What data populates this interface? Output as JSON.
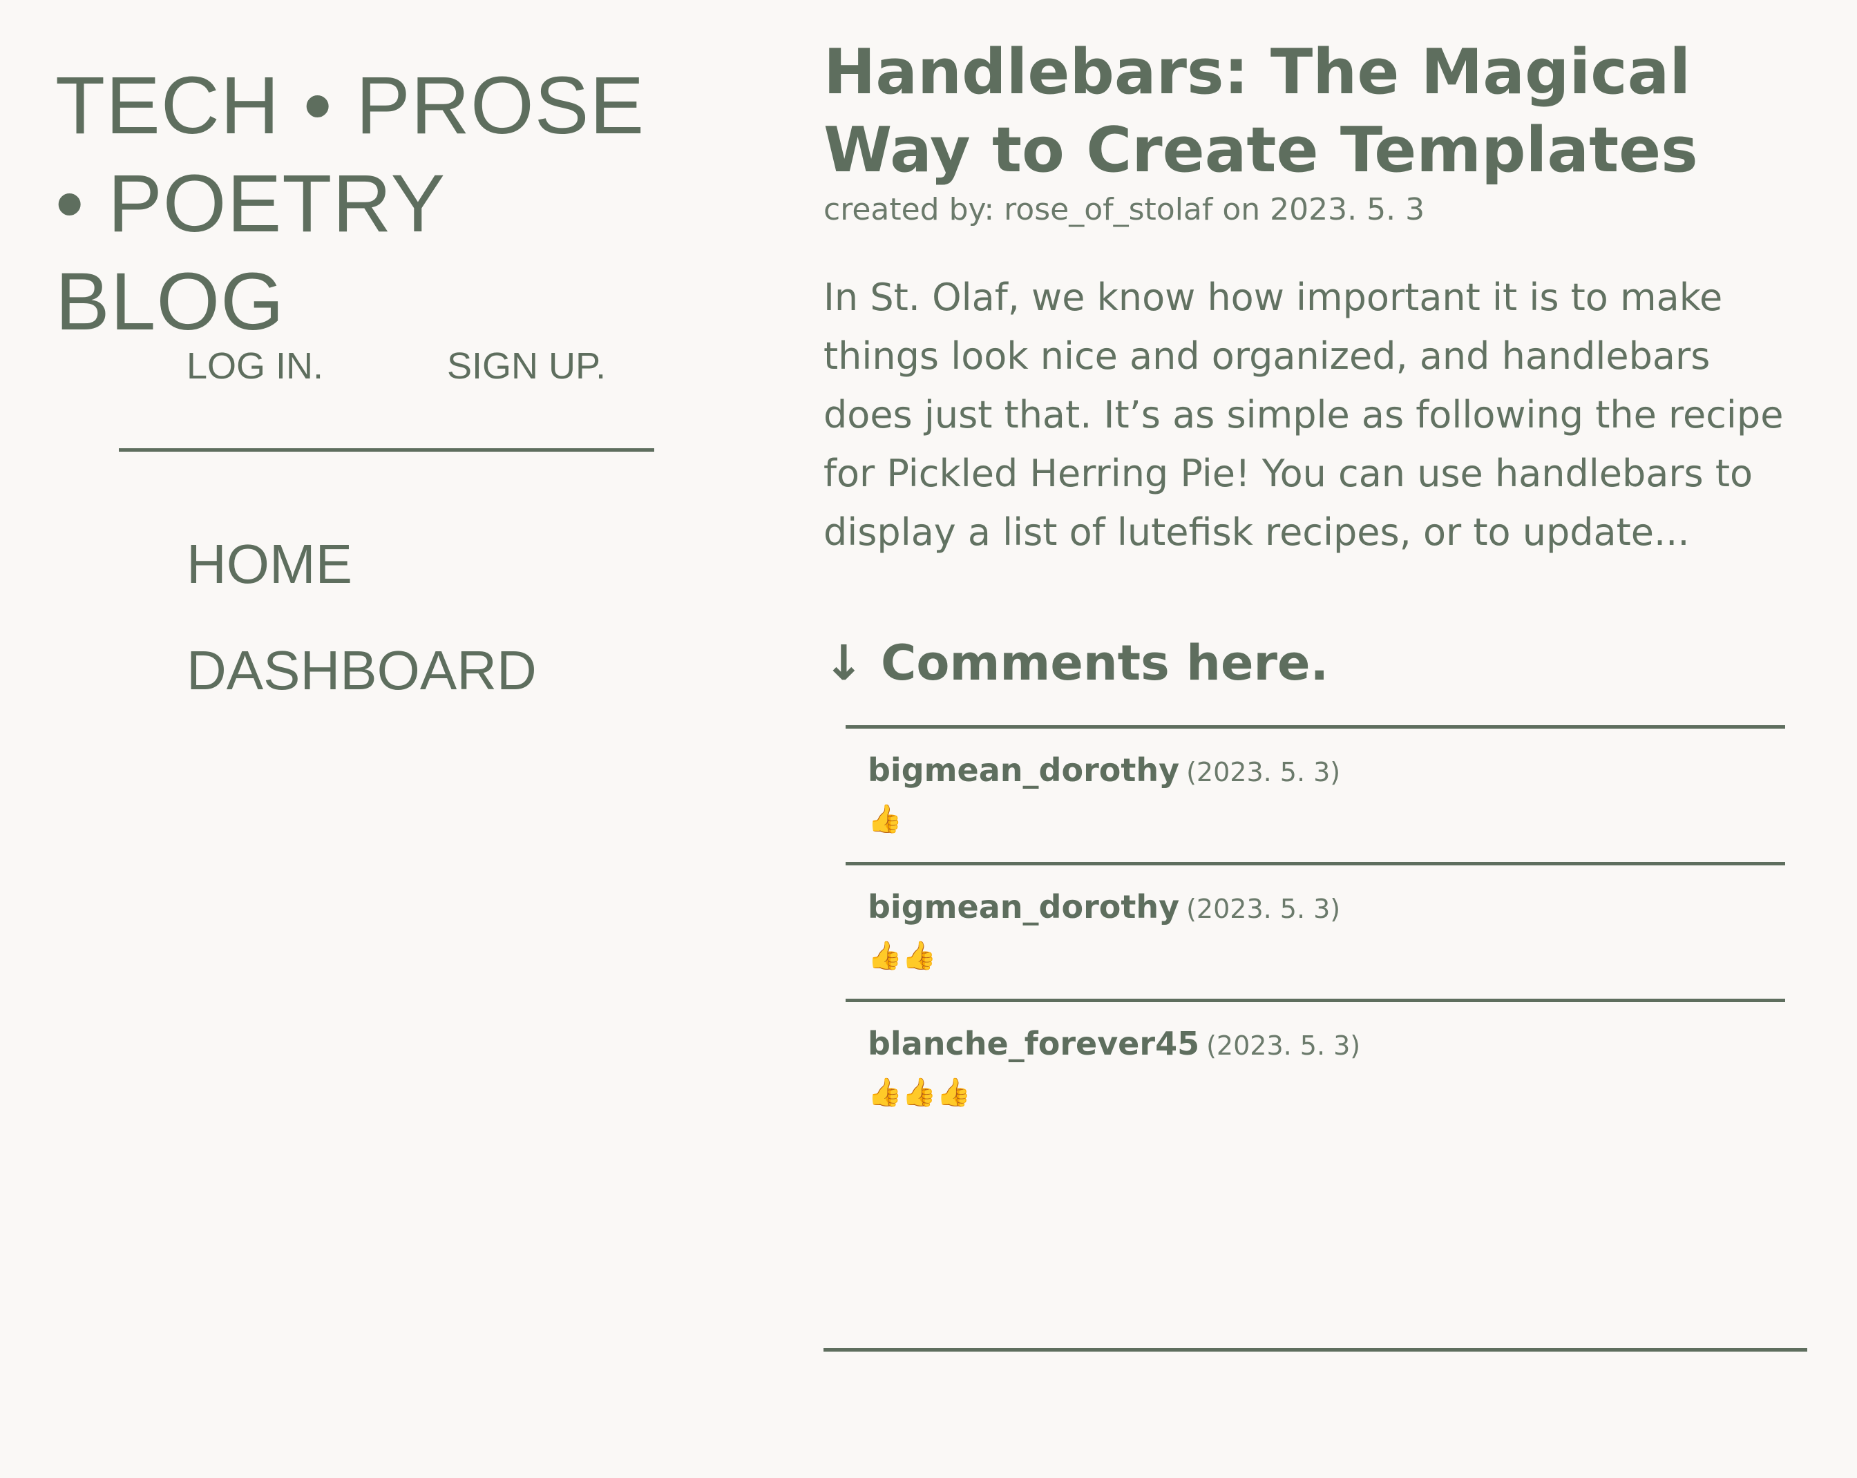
{
  "site": {
    "title": "TECH • PROSE • POETRY BLOG"
  },
  "auth": {
    "login_label": "LOG IN.",
    "signup_label": "SIGN UP."
  },
  "nav": {
    "items": [
      {
        "label": "HOME"
      },
      {
        "label": "DASHBOARD"
      }
    ]
  },
  "post": {
    "title": "Handlebars: The Magical Way to Create Templates",
    "meta": "created by: rose_of_stolaf on 2023. 5. 3",
    "excerpt": "In St. Olaf, we know how important it is to make things look nice and organized, and handlebars does just that. It’s as simple as following the recipe for Pickled Herring Pie! You can use handlebars to display a list of lutefisk recipes, or to update..."
  },
  "comments": {
    "heading": "↓ Comments here.",
    "items": [
      {
        "author": "bigmean_dorothy",
        "date": "(2023. 5. 3)",
        "body": "👍"
      },
      {
        "author": "bigmean_dorothy",
        "date": "(2023. 5. 3)",
        "body": "👍👍"
      },
      {
        "author": "blanche_forever45",
        "date": "(2023. 5. 3)",
        "body": "👍👍👍"
      }
    ]
  },
  "colors": {
    "background": "#faf8f6",
    "text": "#5e6e5e",
    "emoji": "#e0a400"
  }
}
